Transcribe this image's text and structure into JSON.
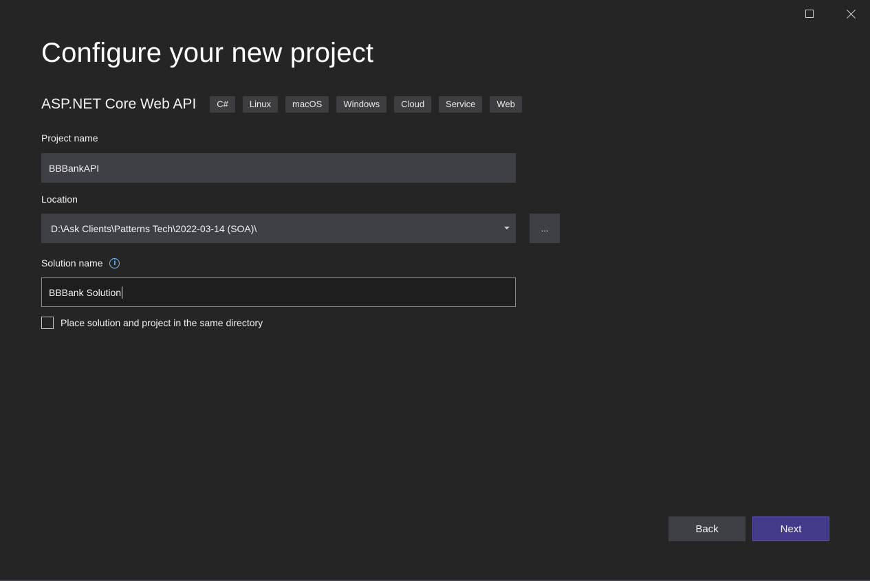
{
  "window": {
    "maximize_icon": "maximize-icon",
    "close_icon": "close-icon"
  },
  "title": "Configure your new project",
  "template": {
    "name": "ASP.NET Core Web API",
    "tags": [
      "C#",
      "Linux",
      "macOS",
      "Windows",
      "Cloud",
      "Service",
      "Web"
    ]
  },
  "project_name": {
    "label": "Project name",
    "value": "BBBankAPI"
  },
  "location": {
    "label": "Location",
    "value": "D:\\Ask Clients\\Patterns Tech\\2022-03-14 (SOA)\\",
    "browse_label": "..."
  },
  "solution_name": {
    "label": "Solution name",
    "info_glyph": "i",
    "value": "BBBank Solution"
  },
  "same_directory": {
    "label": "Place solution and project in the same directory",
    "checked": false
  },
  "buttons": {
    "back": "Back",
    "next": "Next"
  },
  "colors": {
    "background": "#252526",
    "accent_next": "#433b8a",
    "info_icon": "#75beff"
  }
}
